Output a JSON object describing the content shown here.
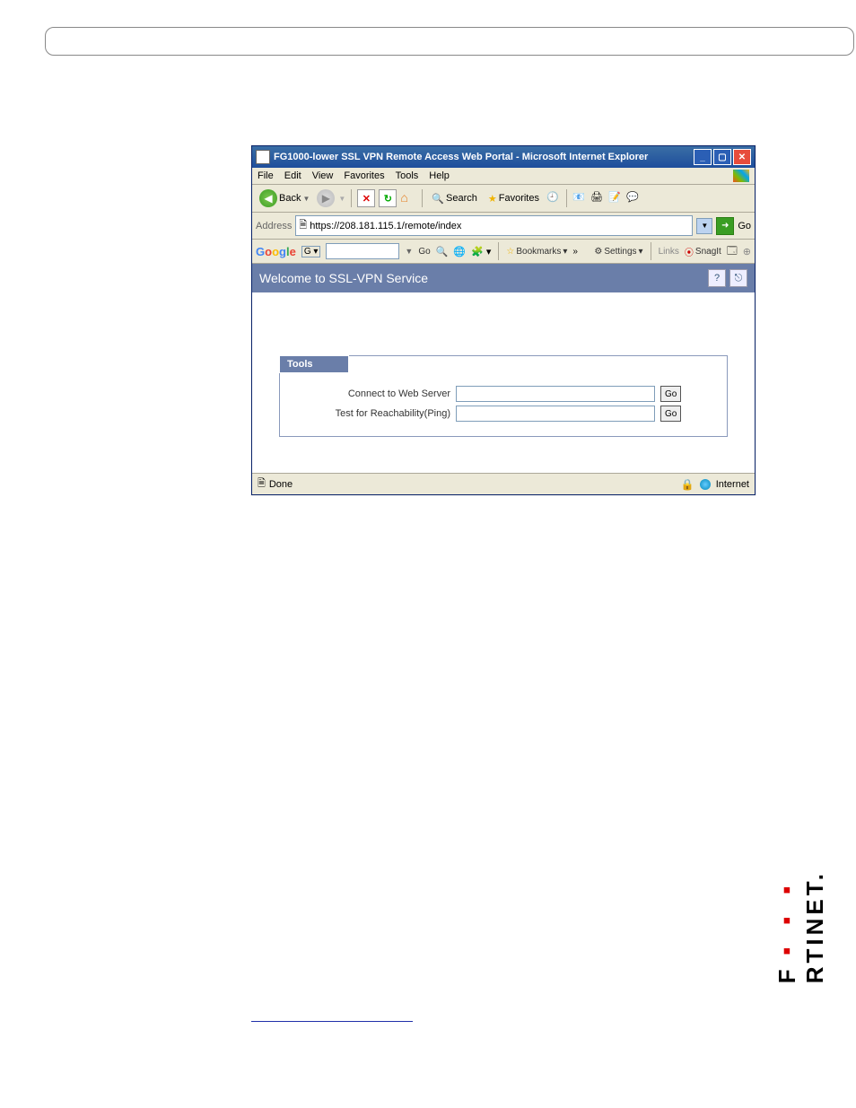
{
  "titlebar": {
    "text": "FG1000-lower SSL VPN Remote Access Web Portal - Microsoft Internet Explorer"
  },
  "menu": {
    "file": "File",
    "edit": "Edit",
    "view": "View",
    "favorites": "Favorites",
    "tools": "Tools",
    "help": "Help"
  },
  "toolbar": {
    "back": "Back",
    "search": "Search",
    "favorites": "Favorites"
  },
  "addressbar": {
    "label": "Address",
    "url": "https://208.181.115.1/remote/index",
    "go": "Go"
  },
  "googlebar": {
    "go": "Go",
    "bookmarks": "Bookmarks",
    "settings": "Settings",
    "links": "Links",
    "snagit": "SnagIt"
  },
  "portal": {
    "welcome": "Welcome to SSL-VPN Service",
    "tools_head": "Tools",
    "connect_label": "Connect to Web Server",
    "reach_label": "Test for Reachability(Ping)",
    "go": "Go"
  },
  "statusbar": {
    "done": "Done",
    "zone": "Internet"
  },
  "fortinet": "FORTINET"
}
